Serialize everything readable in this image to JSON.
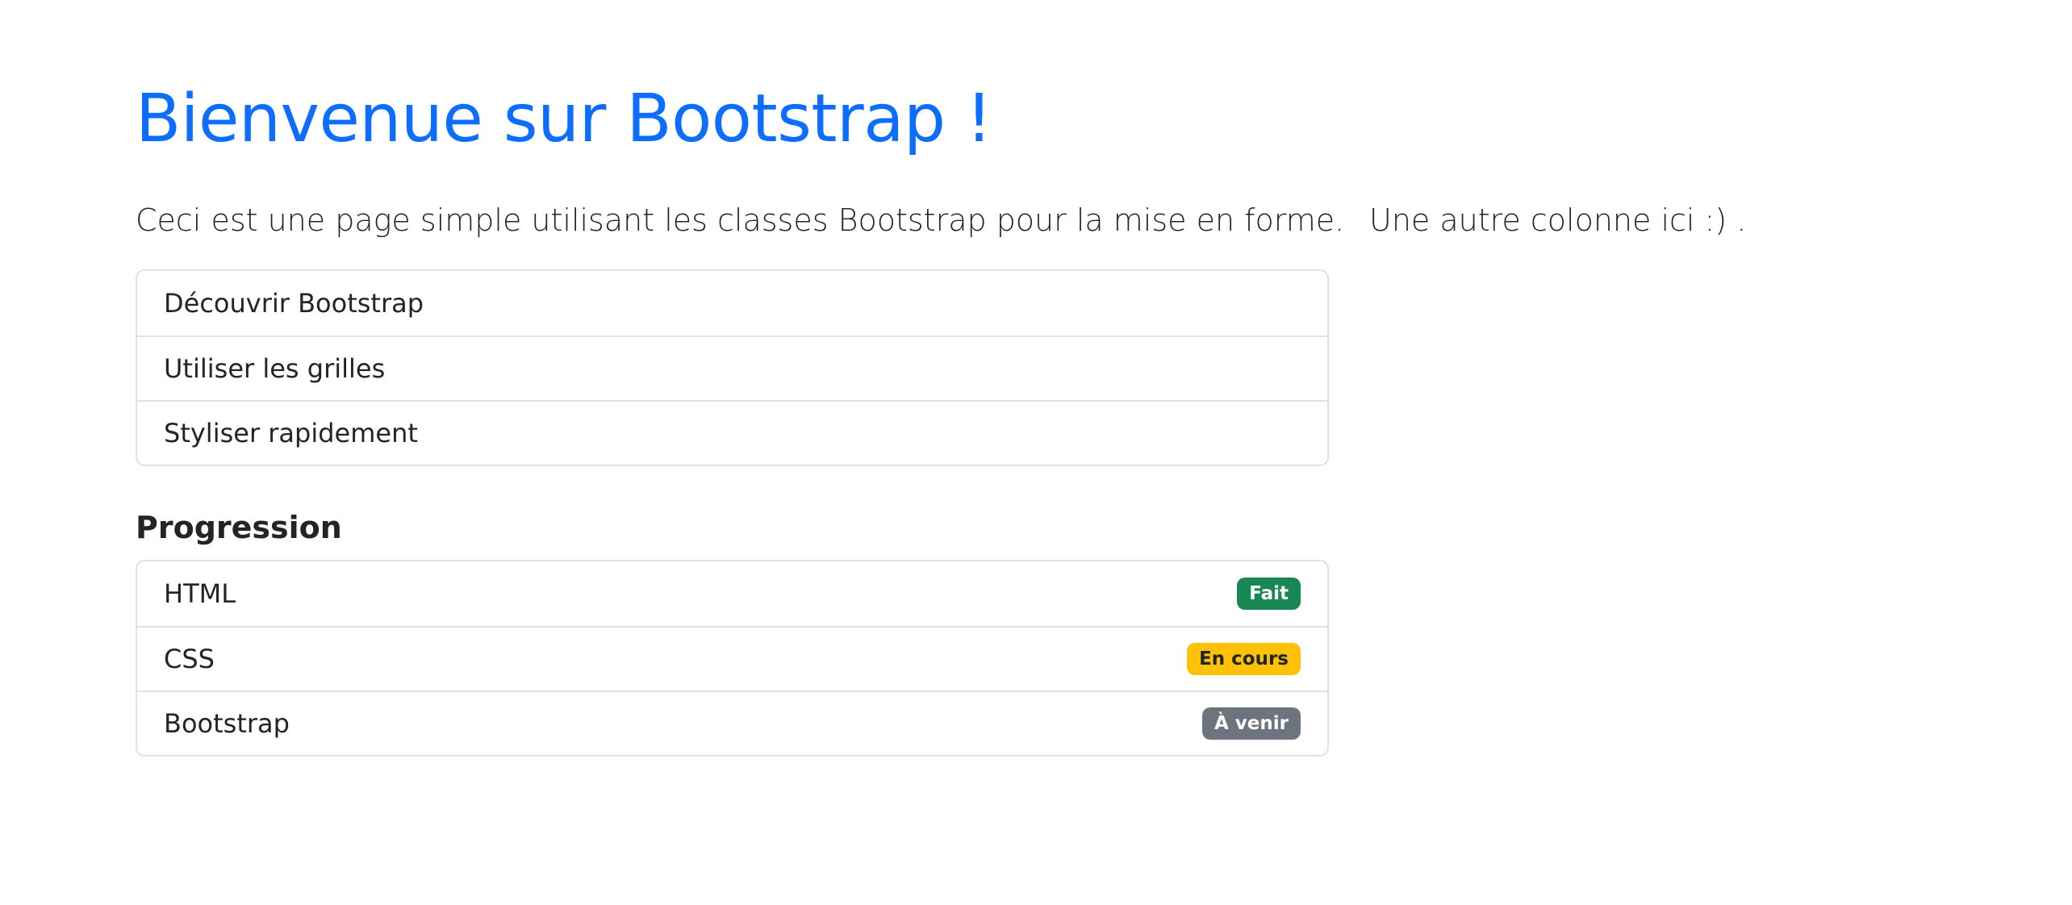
{
  "header": {
    "title": "Bienvenue sur Bootstrap !"
  },
  "intro": {
    "left_text": "Ceci est une page simple utilisant les classes Bootstrap pour la mise en forme.",
    "right_text": "Une autre colonne ici :) ."
  },
  "steps": {
    "items": [
      {
        "label": "Découvrir Bootstrap"
      },
      {
        "label": "Utiliser les grilles"
      },
      {
        "label": "Styliser rapidement"
      }
    ]
  },
  "progress": {
    "title": "Progression",
    "items": [
      {
        "label": "HTML",
        "badge": "Fait",
        "badge_bg": "#198754",
        "badge_fg": "#ffffff"
      },
      {
        "label": "CSS",
        "badge": "En cours",
        "badge_bg": "#ffc107",
        "badge_fg": "#212529"
      },
      {
        "label": "Bootstrap",
        "badge": "À venir",
        "badge_bg": "#6c757d",
        "badge_fg": "#ffffff"
      }
    ]
  },
  "colors": {
    "primary": "#0d6efd",
    "text": "#212529",
    "border": "#dee2e6"
  }
}
